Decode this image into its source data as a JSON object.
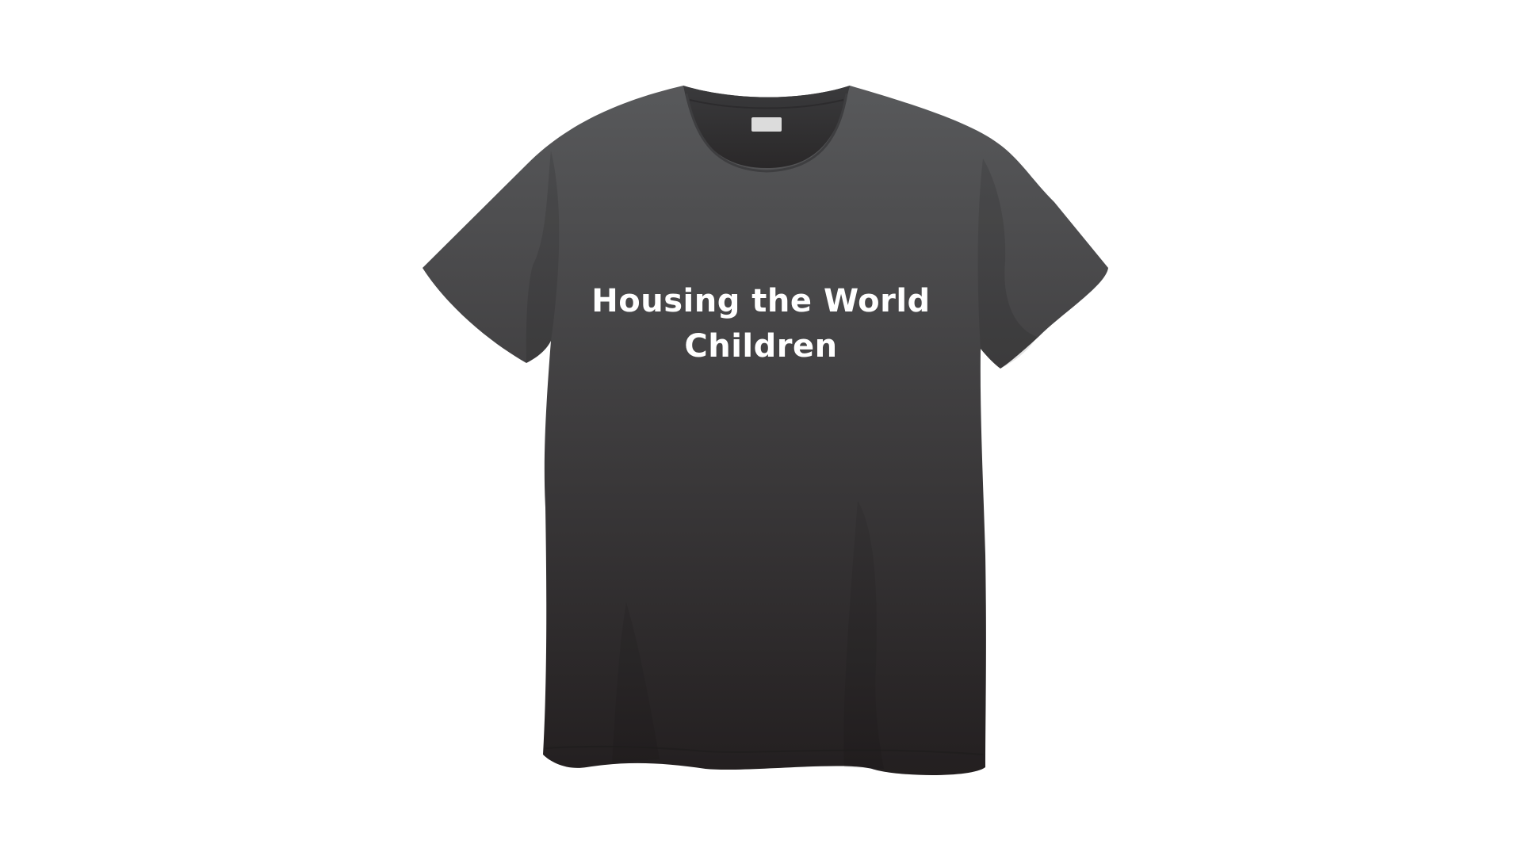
{
  "shirt": {
    "print_line_1": "Housing the World",
    "print_line_2": "Children"
  },
  "colors": {
    "background": "#ffffff",
    "shirt_top": "#58595b",
    "shirt_bottom": "#231f20",
    "neck_tag": "#dcdcdc",
    "print_text": "#ffffff"
  },
  "icons": {
    "garment": "t-shirt-icon",
    "label": "neck-tag-icon"
  }
}
